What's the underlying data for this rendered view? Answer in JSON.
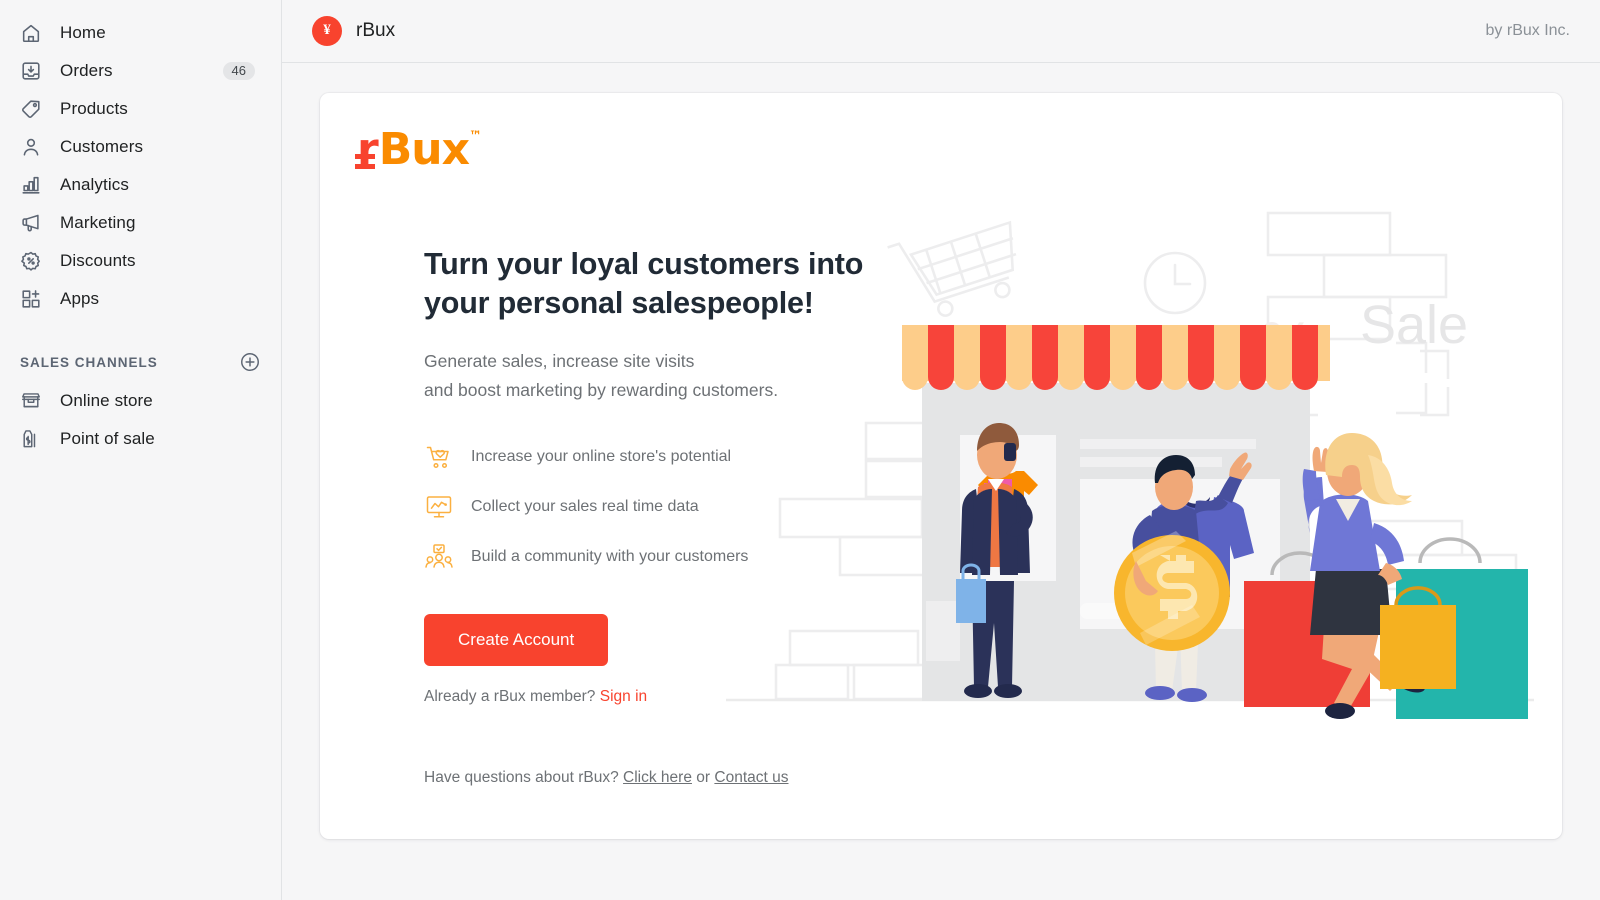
{
  "sidebar": {
    "items": [
      {
        "label": "Home",
        "icon": "home-icon",
        "badge": ""
      },
      {
        "label": "Orders",
        "icon": "orders-icon",
        "badge": "46"
      },
      {
        "label": "Products",
        "icon": "products-icon",
        "badge": ""
      },
      {
        "label": "Customers",
        "icon": "customers-icon",
        "badge": ""
      },
      {
        "label": "Analytics",
        "icon": "analytics-icon",
        "badge": ""
      },
      {
        "label": "Marketing",
        "icon": "marketing-icon",
        "badge": ""
      },
      {
        "label": "Discounts",
        "icon": "discounts-icon",
        "badge": ""
      },
      {
        "label": "Apps",
        "icon": "apps-icon",
        "badge": ""
      }
    ],
    "section": {
      "title": "SALES CHANNELS",
      "add_icon": "plus-circle-icon",
      "channels": [
        {
          "label": "Online store",
          "icon": "store-icon"
        },
        {
          "label": "Point of sale",
          "icon": "point-of-sale-icon"
        }
      ]
    }
  },
  "topbar": {
    "app_icon": "rbux-avatar-icon",
    "app_icon_glyph": "¥",
    "title": "rBux",
    "byline": "by rBux Inc."
  },
  "card": {
    "logo": {
      "r": "r",
      "bux": "Bux",
      "tm": "™"
    },
    "headline": "Turn your loyal customers into your personal salespeople!",
    "subhead_line1": "Generate sales, increase site visits",
    "subhead_line2": "and boost marketing by rewarding customers.",
    "features": [
      {
        "icon": "cart-heart-icon",
        "text": "Increase your online store's potential"
      },
      {
        "icon": "monitor-chart-icon",
        "text": "Collect your sales real time data"
      },
      {
        "icon": "community-icon",
        "text": "Build a community with your customers"
      }
    ],
    "cta_label": "Create Account",
    "member_prompt": "Already a rBux member?",
    "sign_in_label": "Sign in",
    "questions_prompt": "Have questions about rBux?",
    "click_here_label": "Click here",
    "questions_or": "or",
    "contact_us_label": "Contact us",
    "illustration": {
      "name": "storefront-shoppers-illustration",
      "sale_text": "Sale",
      "percent_text": "%",
      "coin_symbol": "$"
    }
  },
  "colors": {
    "brand_red": "#f8432e",
    "brand_orange": "#fa8b00",
    "accent_yellow": "#fbb040",
    "sidebar_bg": "#f6f6f7",
    "text_dark": "#202223",
    "text_muted": "#6d7175",
    "awning_red": "#f7443a",
    "awning_peach": "#fdcd8a",
    "character_blue": "#5b63c4",
    "bag_teal": "#23b5ab",
    "bag_red": "#ef3e36",
    "bag_yellow": "#f5b120",
    "coin_gold": "#f8b62d",
    "suit_navy": "#2b3259"
  }
}
